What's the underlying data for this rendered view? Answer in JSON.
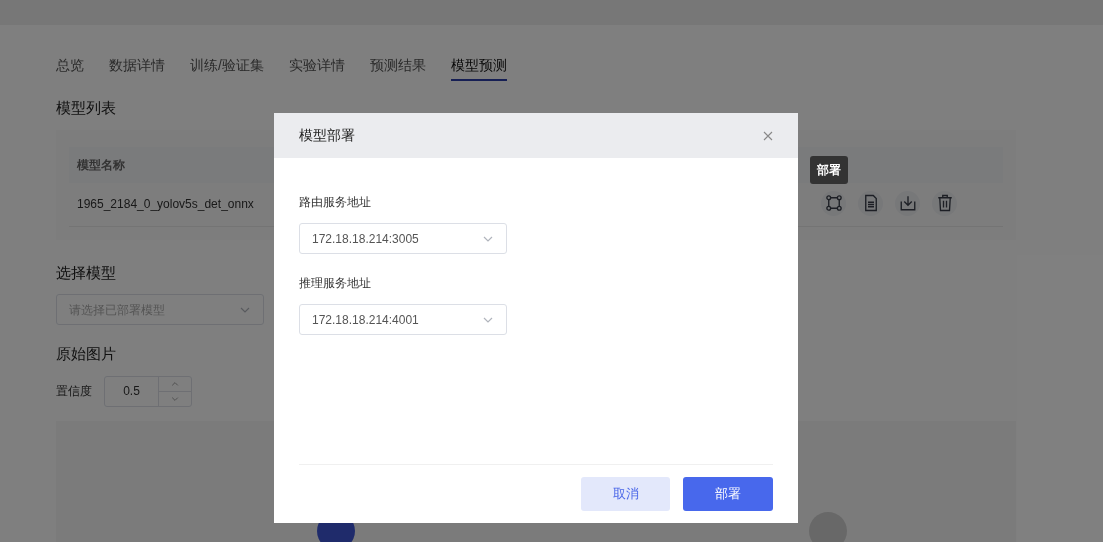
{
  "tabs": [
    {
      "label": "总览",
      "selected": false
    },
    {
      "label": "数据详情",
      "selected": false
    },
    {
      "label": "训练/验证集",
      "selected": false
    },
    {
      "label": "实验详情",
      "selected": false
    },
    {
      "label": "预测结果",
      "selected": false
    },
    {
      "label": "模型预测",
      "selected": true
    }
  ],
  "model_list": {
    "title": "模型列表",
    "columns": [
      "模型名称"
    ],
    "rows": [
      {
        "name": "1965_2184_0_yolov5s_det_onnx"
      }
    ],
    "actions": [
      {
        "kind": "deploy"
      },
      {
        "kind": "document"
      },
      {
        "kind": "download"
      },
      {
        "kind": "delete"
      }
    ],
    "tooltip": "部署"
  },
  "select_model": {
    "title": "选择模型",
    "placeholder": "请选择已部署模型"
  },
  "original_image": {
    "title": "原始图片",
    "confidence_label": "置信度",
    "confidence": "0.5"
  },
  "dialog": {
    "title": "模型部署",
    "fields": [
      {
        "label": "路由服务地址",
        "value": "172.18.18.214:3005"
      },
      {
        "label": "推理服务地址",
        "value": "172.18.18.214:4001"
      }
    ],
    "buttons": [
      {
        "label": "取消",
        "kind": "secondary"
      },
      {
        "label": "部署",
        "kind": "primary"
      }
    ]
  }
}
